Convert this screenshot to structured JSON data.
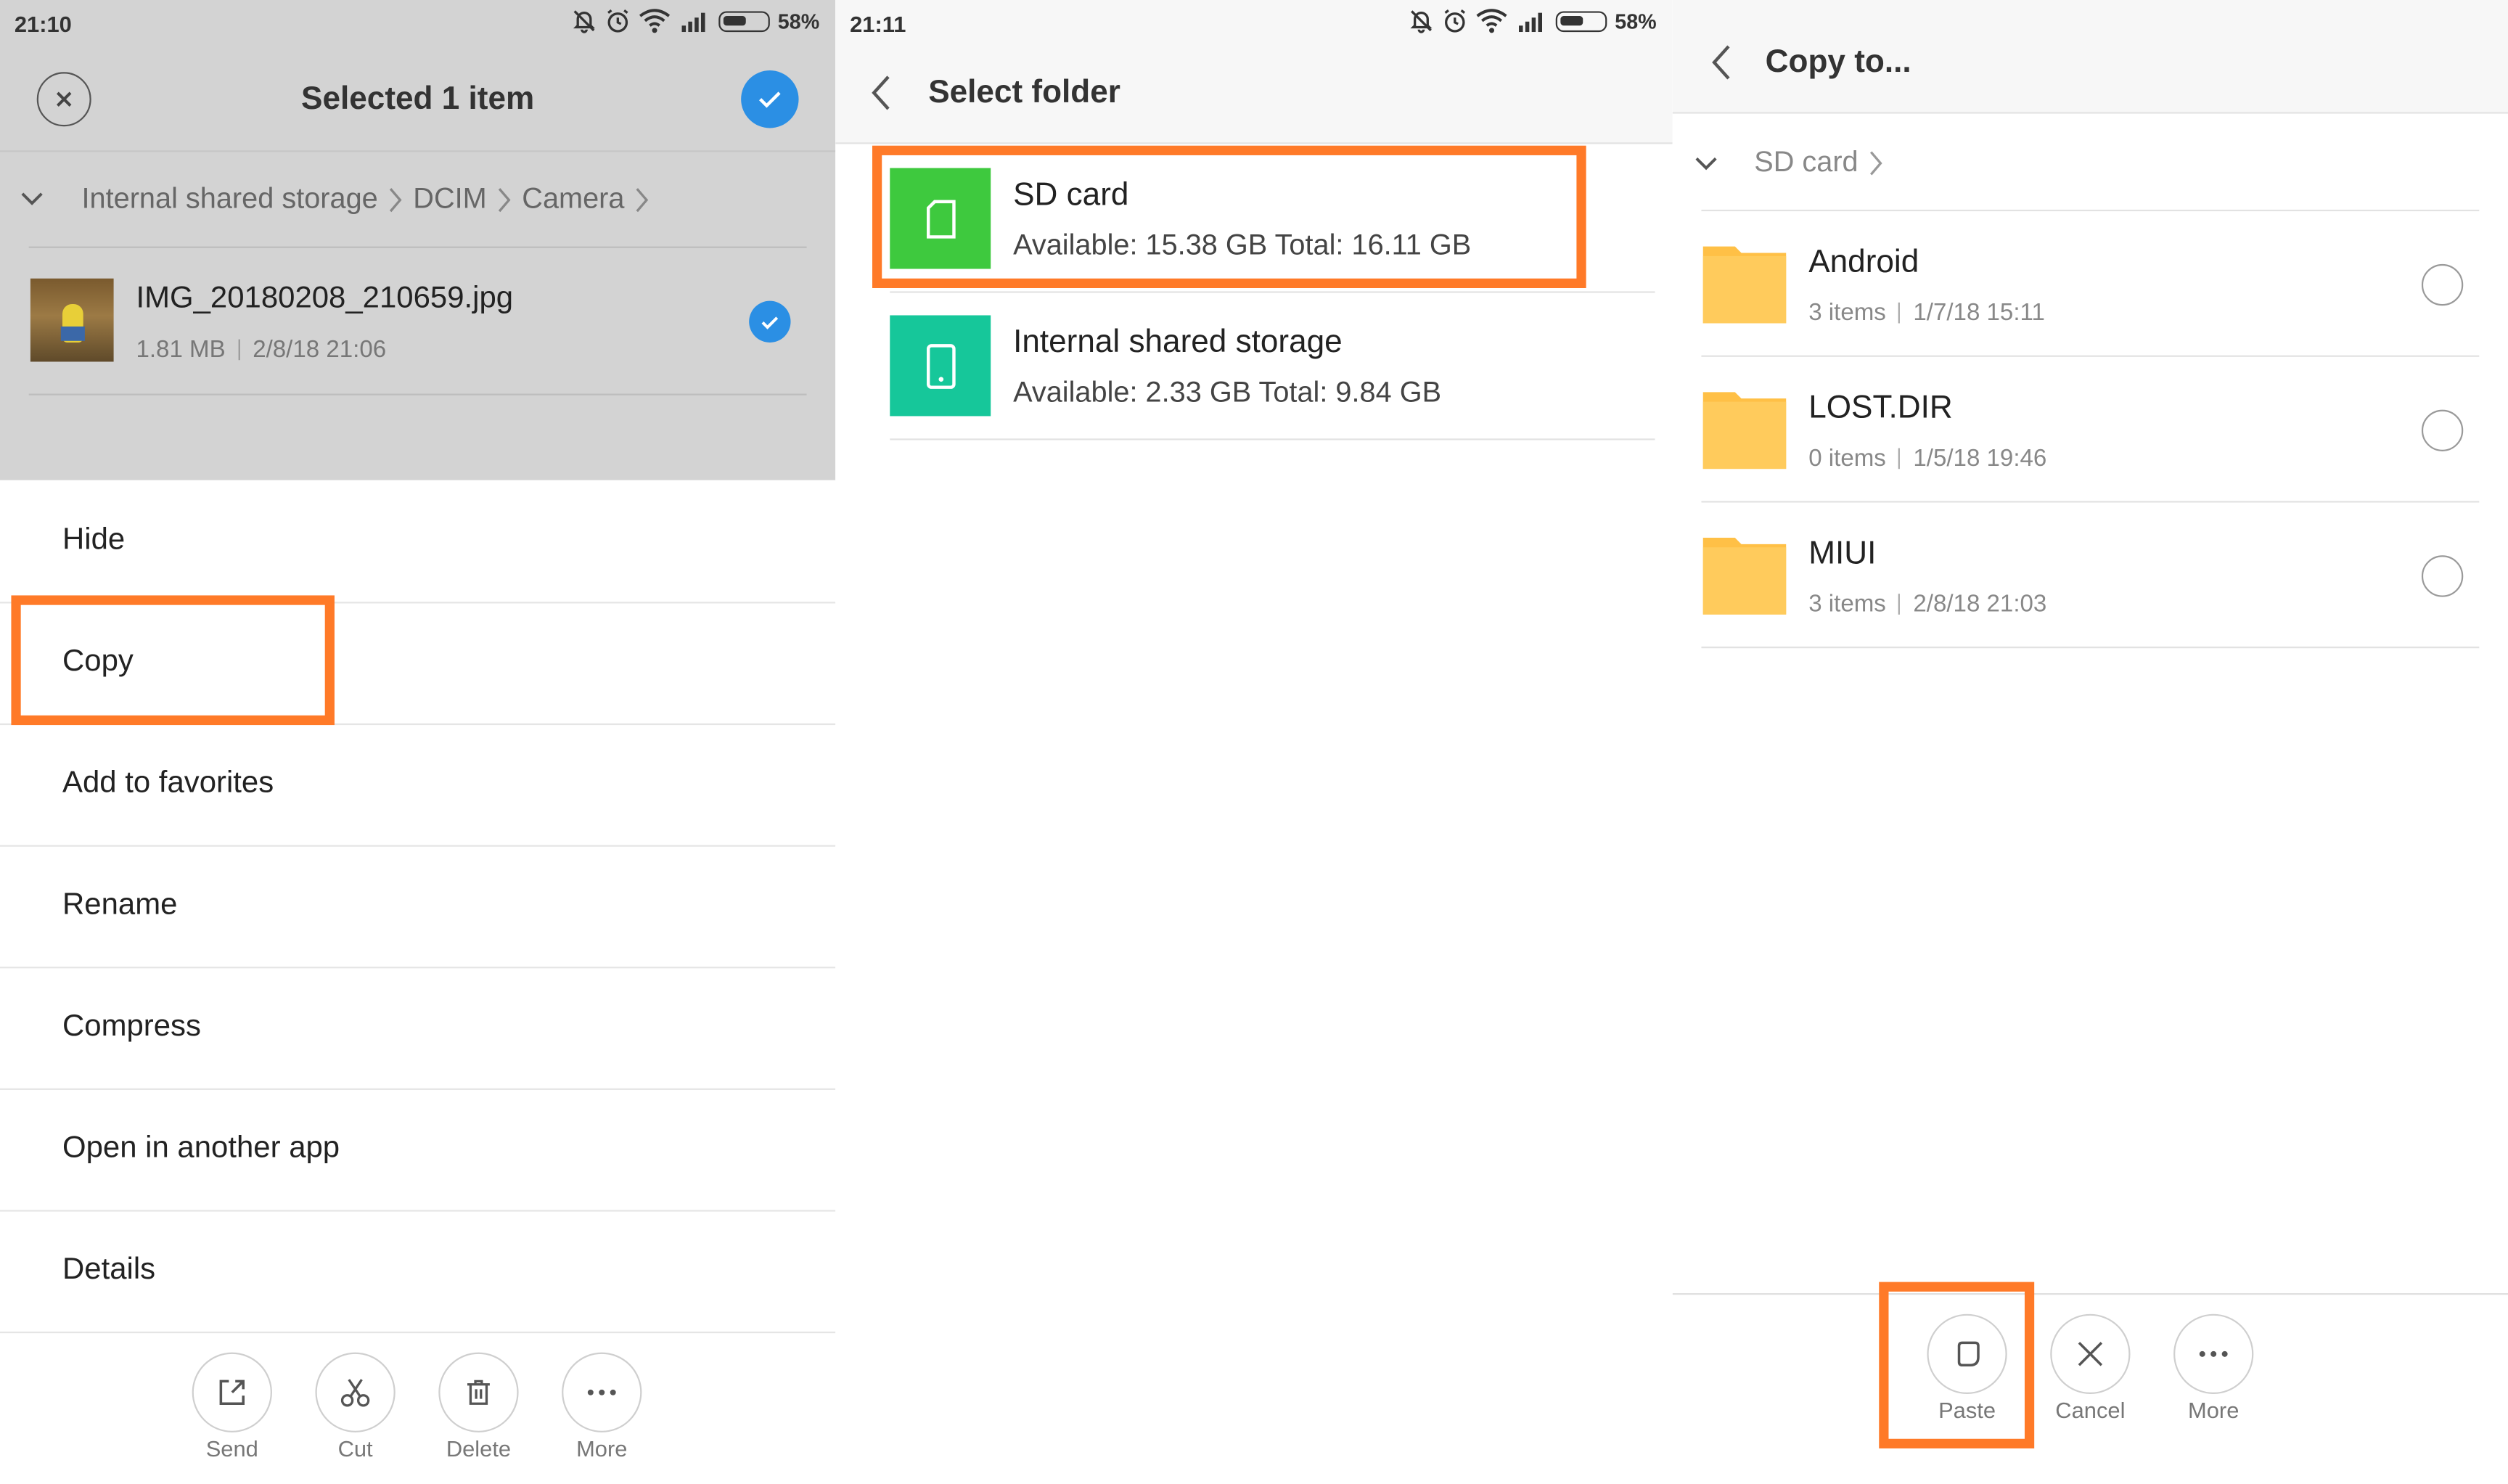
{
  "screen1": {
    "status": {
      "time": "21:10",
      "battery": "58%"
    },
    "header": {
      "title": "Selected 1 item"
    },
    "breadcrumb": [
      "Internal shared storage",
      "DCIM",
      "Camera"
    ],
    "file": {
      "name": "IMG_20180208_210659.jpg",
      "size": "1.81 MB",
      "date": "2/8/18 21:06"
    },
    "menu": [
      "Hide",
      "Copy",
      "Add to favorites",
      "Rename",
      "Compress",
      "Open in another app",
      "Details"
    ],
    "bottom_actions": [
      "Send",
      "Cut",
      "Delete",
      "More"
    ]
  },
  "screen2": {
    "status": {
      "time": "21:11",
      "battery": "58%"
    },
    "header": {
      "title": "Select folder"
    },
    "storages": [
      {
        "name": "SD card",
        "details": "Available: 15.38 GB Total: 16.11 GB",
        "color": "#3ec93e"
      },
      {
        "name": "Internal shared storage",
        "details": "Available: 2.33 GB Total: 9.84 GB",
        "color": "#16c79a"
      }
    ]
  },
  "screen3": {
    "header": {
      "title": "Copy to..."
    },
    "breadcrumb": [
      "SD card"
    ],
    "folders": [
      {
        "name": "Android",
        "items": "3 items",
        "date": "1/7/18 15:11"
      },
      {
        "name": "LOST.DIR",
        "items": "0 items",
        "date": "1/5/18 19:46"
      },
      {
        "name": "MIUI",
        "items": "3 items",
        "date": "2/8/18 21:03"
      }
    ],
    "bottom_actions": [
      "Paste",
      "Cancel",
      "More"
    ]
  },
  "colors": {
    "highlight": "#ff7a28",
    "accent": "#2b8fe4",
    "folder": "#ffc046"
  },
  "icons": [
    "close-icon",
    "check-icon",
    "chevron-down-icon",
    "chevron-right-icon",
    "back-arrow-icon",
    "sd-card-icon",
    "phone-icon",
    "folder-icon",
    "send-icon",
    "scissors-icon",
    "trash-icon",
    "more-dots-icon",
    "paste-icon",
    "cancel-x-icon",
    "bell-off-icon",
    "alarm-icon",
    "wifi-icon",
    "signal-icon",
    "battery-icon"
  ]
}
